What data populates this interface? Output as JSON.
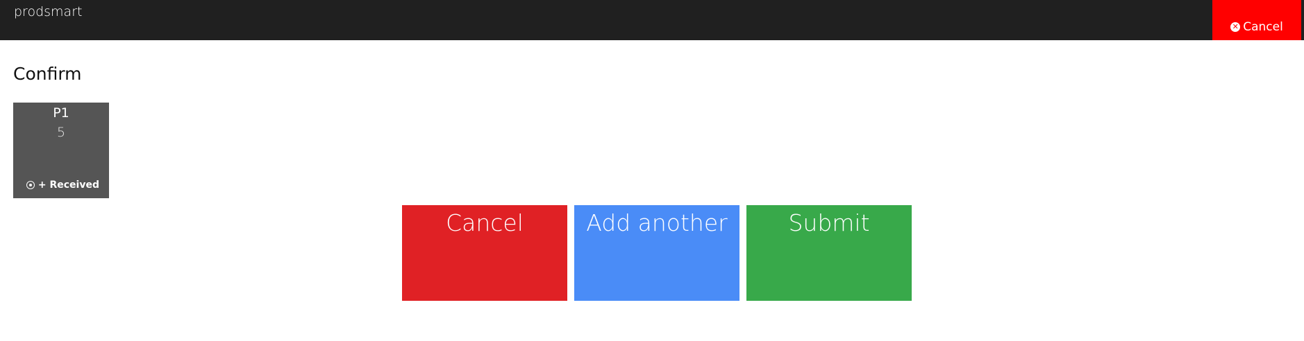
{
  "header": {
    "brand": "prodsmart",
    "cancel_label": "Cancel",
    "cancel_color": "#ff0000"
  },
  "page": {
    "title": "Confirm"
  },
  "items": [
    {
      "name": "P1",
      "quantity": "5",
      "status": "+ Received",
      "color": "#555555"
    }
  ],
  "actions": {
    "cancel": {
      "label": "Cancel",
      "color": "#e02125"
    },
    "add_another": {
      "label": "Add another",
      "color": "#4a8cf7"
    },
    "submit": {
      "label": "Submit",
      "color": "#38a94a"
    }
  }
}
